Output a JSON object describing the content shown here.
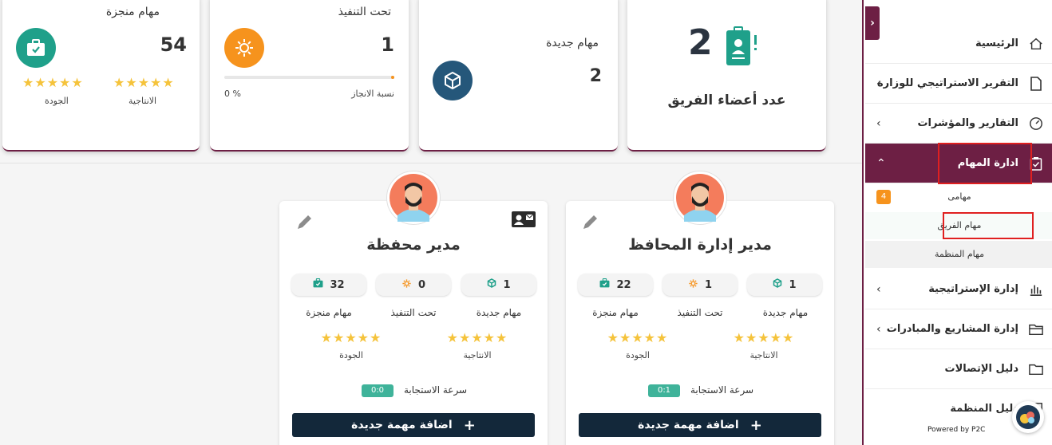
{
  "stats": {
    "completed": {
      "title": "مهام منجزة",
      "value": "54",
      "productivity_label": "الانتاجية",
      "quality_label": "الجودة",
      "productivity_stars": 5,
      "quality_stars": 5
    },
    "in_progress": {
      "title": "تحت التنفيذ",
      "value": "1",
      "progress_label": "نسبة الانجاز",
      "progress_value": "0 %",
      "progress_fraction": 0.02
    },
    "new_tasks": {
      "title": "مهام جديدة",
      "value": "2"
    },
    "team": {
      "value": "2",
      "label": "عدد أعضاء الفريق"
    }
  },
  "members": [
    {
      "title": "مدير إدارة المحافظ",
      "new_value": "1",
      "in_progress_value": "1",
      "completed_value": "22",
      "new_label": "مهام جديدة",
      "in_progress_label": "تحت التنفيذ",
      "completed_label": "مهام منجزة",
      "productivity_label": "الانتاجية",
      "quality_label": "الجودة",
      "speed_label": "سرعة الاستجابة",
      "speed_value": "0:1",
      "add_label": "اضافة مهمة جديدة"
    },
    {
      "title": "مدير محفظة",
      "new_value": "1",
      "in_progress_value": "0",
      "completed_value": "32",
      "new_label": "مهام جديدة",
      "in_progress_label": "تحت التنفيذ",
      "completed_label": "مهام منجزة",
      "productivity_label": "الانتاجية",
      "quality_label": "الجودة",
      "speed_label": "سرعة الاستجابة",
      "speed_value": "0:0",
      "add_label": "اضافة مهمة جديدة"
    }
  ],
  "stars_text": "★★★★★",
  "sidebar": {
    "items": [
      {
        "label": "الرئيسية",
        "icon": "home-icon"
      },
      {
        "label": "التقرير الاستراتيجي للوزارة",
        "icon": "document-icon"
      },
      {
        "label": "التقارير والمؤشرات",
        "icon": "gauge-icon"
      },
      {
        "label": "ادارة المهام",
        "icon": "clipboard-icon"
      },
      {
        "label": "إدارة الإستراتيجية",
        "icon": "bar-chart-icon"
      },
      {
        "label": "إدارة المشاريع والمبادرات",
        "icon": "folder-open-icon"
      },
      {
        "label": "دليل الإتصالات",
        "icon": "folder-icon"
      },
      {
        "label": "دليل المنظمة",
        "icon": "org-icon"
      }
    ],
    "sub_items": [
      {
        "label": "مهامى",
        "badge": "4"
      },
      {
        "label": "مهام الفريق"
      },
      {
        "label": "مهام المنظمة"
      }
    ],
    "powered_by": "Powered by P2C"
  },
  "colors": {
    "brand": "#6d1f44",
    "teal": "#1fa08a",
    "orange": "#f6931d",
    "navy": "#25577a",
    "dark_button": "#13283a",
    "star": "#f5c33b"
  }
}
